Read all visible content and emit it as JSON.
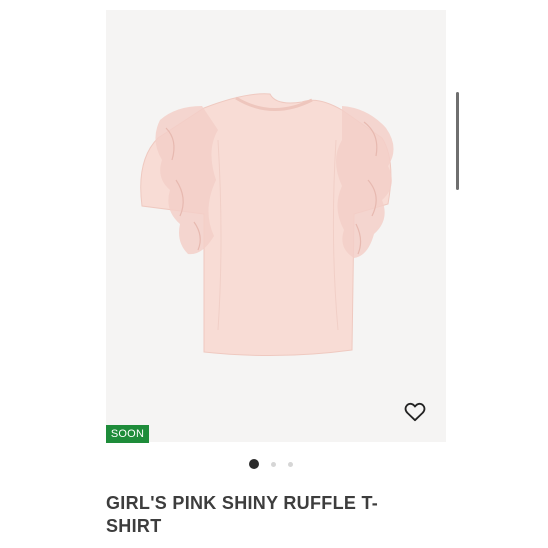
{
  "product": {
    "badge": "SOON",
    "title": "GIRL'S PINK SHINY RUFFLE T-SHIRT",
    "image_subject": "pink ruffle t-shirt",
    "wishlist_icon": "heart-outline-icon"
  },
  "carousel": {
    "total_slides": 3,
    "active_index": 0
  },
  "colors": {
    "badge_bg": "#1e8c3a",
    "shirt": "#f7d9d2",
    "title": "#3d3d3d"
  }
}
